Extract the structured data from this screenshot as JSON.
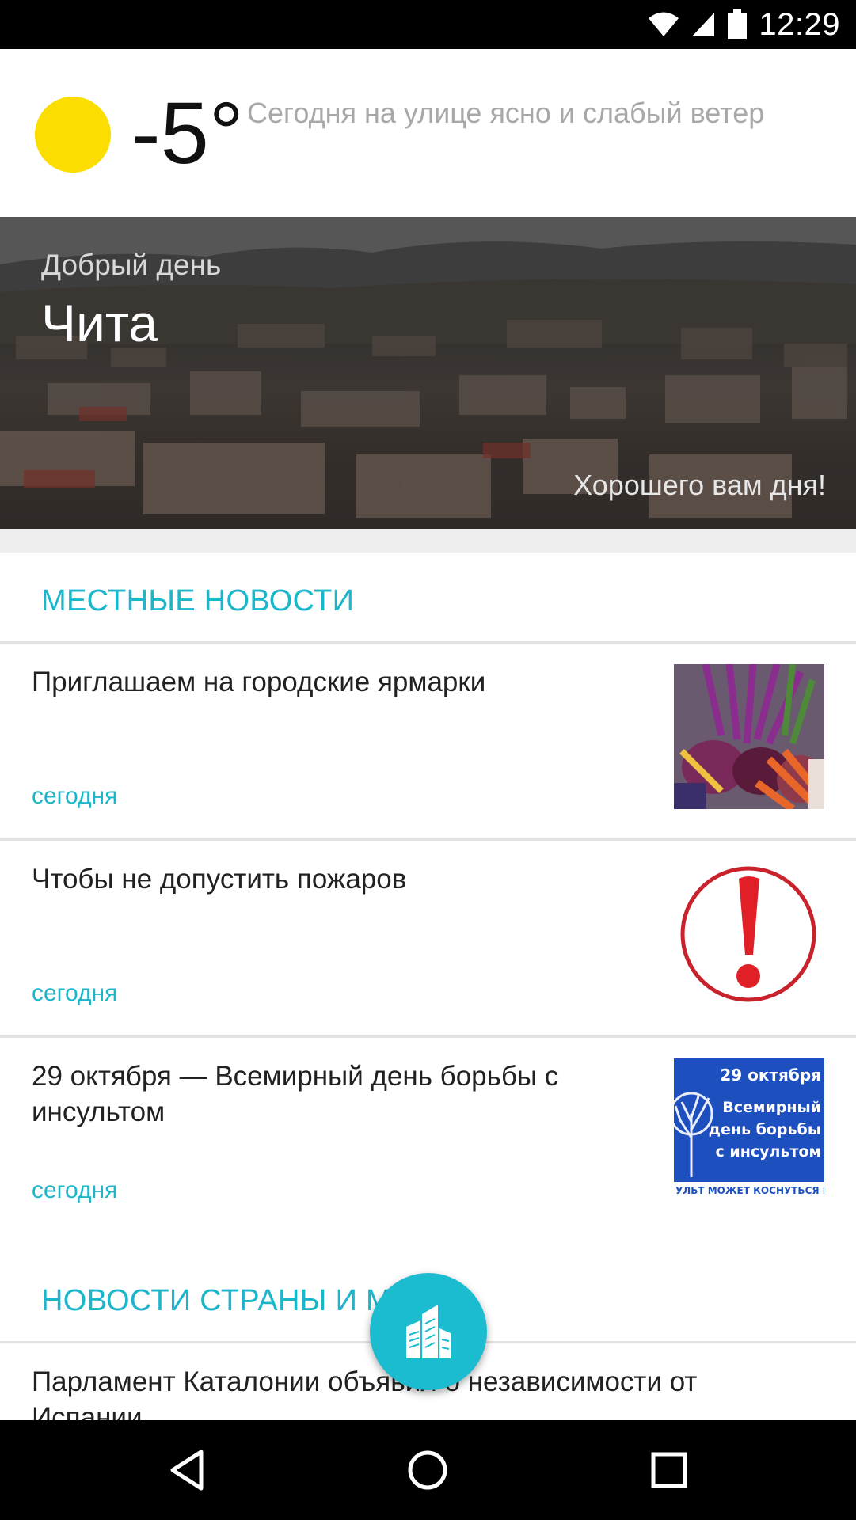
{
  "status_bar": {
    "time": "12:29",
    "icons": [
      "wifi-icon",
      "cell-signal-icon",
      "battery-icon"
    ]
  },
  "weather": {
    "temperature": "-5°",
    "description": "Сегодня на улице ясно и слабый ветер",
    "icon": "sun-icon",
    "icon_color": "#fbdd00"
  },
  "banner": {
    "greeting": "Добрый день",
    "city": "Чита",
    "wish": "Хорошего вам дня!"
  },
  "local_news": {
    "title": "МЕСТНЫЕ НОВОСТИ",
    "items": [
      {
        "title": "Приглашаем на городские ярмарки",
        "date": "сегодня",
        "thumb": "vegetables-image"
      },
      {
        "title": "Чтобы не допустить пожаров",
        "date": "сегодня",
        "thumb": "warning-image"
      },
      {
        "title": "29 октября — Всемирный день борьбы с инсультом",
        "date": "сегодня",
        "thumb": "stroke-day-image",
        "thumb_text": [
          "29 октября",
          "Всемирный",
          "день борьбы",
          "с инсультом",
          "УЛЬТ МОЖЕТ КОСНУТЬСЯ КАЖД"
        ]
      }
    ]
  },
  "world_news": {
    "title": "НОВОСТИ СТРАНЫ И МИРА",
    "items": [
      {
        "title": "Парламент Каталонии объявил о независимости от Испании"
      }
    ]
  },
  "fab": {
    "icon": "city-buildings-icon"
  },
  "nav": {
    "back": "back-icon",
    "home": "home-icon",
    "recents": "recents-icon"
  },
  "colors": {
    "accent": "#1cb6cb",
    "fab": "#1cbcd0"
  }
}
